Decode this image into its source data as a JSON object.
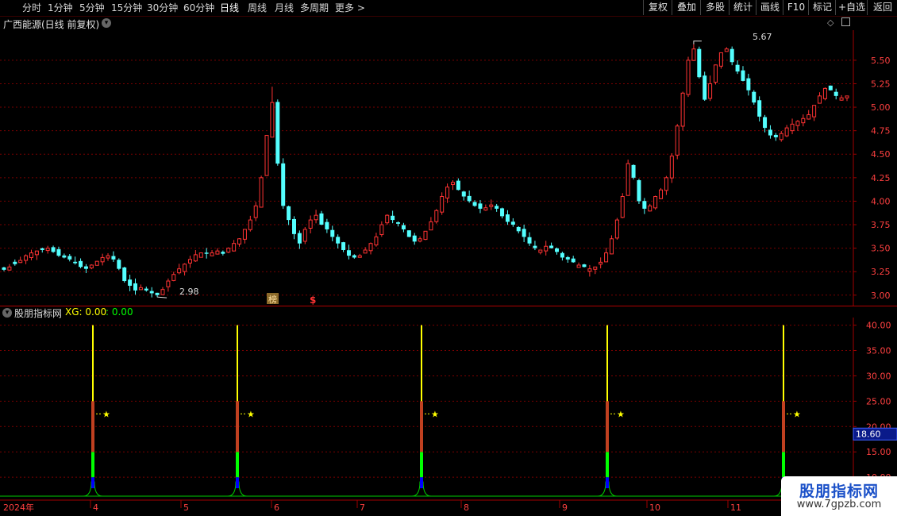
{
  "toolbar": {
    "periods": [
      "分时",
      "1分钟",
      "5分钟",
      "15分钟",
      "30分钟",
      "60分钟",
      "日线",
      "周线",
      "月线",
      "多周期",
      "更多 >"
    ],
    "active_period": "日线",
    "functions": [
      "复权",
      "叠加",
      "多股",
      "统计",
      "画线",
      "F10",
      "标记",
      "+自选",
      "返回"
    ]
  },
  "chart_title": "广西能源(日线 前复权)",
  "markers": {
    "high_label": "5.67",
    "low_label": "2.98",
    "bang_badge": "榜",
    "dollar_badge": "$"
  },
  "indicator": {
    "name": "股朋指标网",
    "xg_label": "XG: 0.00",
    "xg_value2": ": 0.00",
    "current_value": "18.60"
  },
  "x_axis": {
    "year_label": "2024年",
    "months": [
      "4",
      "5",
      "6",
      "7",
      "8",
      "9",
      "10",
      "11"
    ]
  },
  "watermark": {
    "line1": "股朋指标网",
    "line2": "www.7gpzb.com"
  },
  "colors": {
    "up": "#ff3333",
    "down": "#54ffff",
    "grid": "#7a0000",
    "signal_yellow": "#ffff00",
    "signal_red": "#ff2020",
    "signal_green": "#00ff00",
    "signal_blue": "#0000ff",
    "baseline": "#00cc00"
  },
  "chart_data": [
    {
      "type": "candlestick",
      "title": "广西能源(日线 前复权)",
      "y_ticks": [
        3.0,
        3.25,
        3.5,
        3.75,
        4.0,
        4.25,
        4.5,
        4.75,
        5.0,
        5.25,
        5.5
      ],
      "ylim": [
        2.88,
        5.82
      ],
      "grid": true,
      "annotations": [
        {
          "label": "5.67",
          "type": "high"
        },
        {
          "label": "2.98",
          "type": "low"
        }
      ],
      "close_path": [
        3.27,
        3.3,
        3.33,
        3.37,
        3.42,
        3.45,
        3.47,
        3.48,
        3.5,
        3.46,
        3.42,
        3.4,
        3.38,
        3.34,
        3.3,
        3.28,
        3.32,
        3.36,
        3.4,
        3.42,
        3.38,
        3.28,
        3.15,
        3.1,
        3.05,
        3.08,
        3.05,
        3.02,
        3.0,
        3.06,
        3.15,
        3.22,
        3.28,
        3.33,
        3.38,
        3.43,
        3.45,
        3.44,
        3.45,
        3.47,
        3.44,
        3.5,
        3.55,
        3.6,
        3.7,
        3.8,
        3.95,
        4.25,
        4.7,
        5.05,
        4.4,
        3.95,
        3.8,
        3.65,
        3.55,
        3.7,
        3.8,
        3.85,
        3.75,
        3.7,
        3.62,
        3.55,
        3.48,
        3.42,
        3.4,
        3.42,
        3.48,
        3.55,
        3.62,
        3.75,
        3.85,
        3.8,
        3.76,
        3.7,
        3.62,
        3.57,
        3.6,
        3.68,
        3.78,
        3.9,
        4.05,
        4.15,
        4.2,
        4.12,
        4.05,
        4.0,
        3.95,
        3.92,
        3.93,
        3.96,
        3.92,
        3.84,
        3.78,
        3.75,
        3.68,
        3.62,
        3.55,
        3.5,
        3.48,
        3.52,
        3.5,
        3.46,
        3.4,
        3.38,
        3.35,
        3.32,
        3.3,
        3.28,
        3.3,
        3.35,
        3.45,
        3.6,
        3.8,
        4.05,
        4.4,
        4.25,
        4.0,
        3.92,
        3.95,
        4.05,
        4.12,
        4.25,
        4.48,
        4.8,
        5.15,
        5.5,
        5.62,
        5.32,
        5.08,
        5.25,
        5.45,
        5.58,
        5.62,
        5.48,
        5.38,
        5.28,
        5.18,
        5.05,
        4.9,
        4.78,
        4.7,
        4.68,
        4.72,
        4.78,
        4.82,
        4.85,
        4.88,
        4.92,
        5.02,
        5.12,
        5.2,
        5.18,
        5.12,
        5.1,
        5.12
      ],
      "close_path_note": "approximate daily price path read from the chart, 152 sessions"
    },
    {
      "type": "signal-bars",
      "title": "股朋指标网",
      "y_ticks": [
        5.0,
        10.0,
        15.0,
        20.0,
        25.0,
        30.0,
        35.0,
        40.0
      ],
      "ylim": [
        5.8,
        41.5
      ],
      "signals": [
        {
          "label": "4",
          "yellow_top": 40,
          "red_top": 25,
          "green_top": 15,
          "blue_top": 10
        },
        {
          "label": "5/6",
          "yellow_top": 40,
          "red_top": 25,
          "green_top": 15,
          "blue_top": 10
        },
        {
          "label": "7/8",
          "yellow_top": 40,
          "red_top": 25,
          "green_top": 15,
          "blue_top": 10
        },
        {
          "label": "9/10",
          "yellow_top": 40,
          "red_top": 25,
          "green_top": 15,
          "blue_top": 10
        },
        {
          "label": "11",
          "yellow_top": 40,
          "red_top": 25,
          "green_top": 15,
          "blue_top": 10
        }
      ],
      "marker_value": 22.5,
      "current_value": 18.6
    }
  ]
}
